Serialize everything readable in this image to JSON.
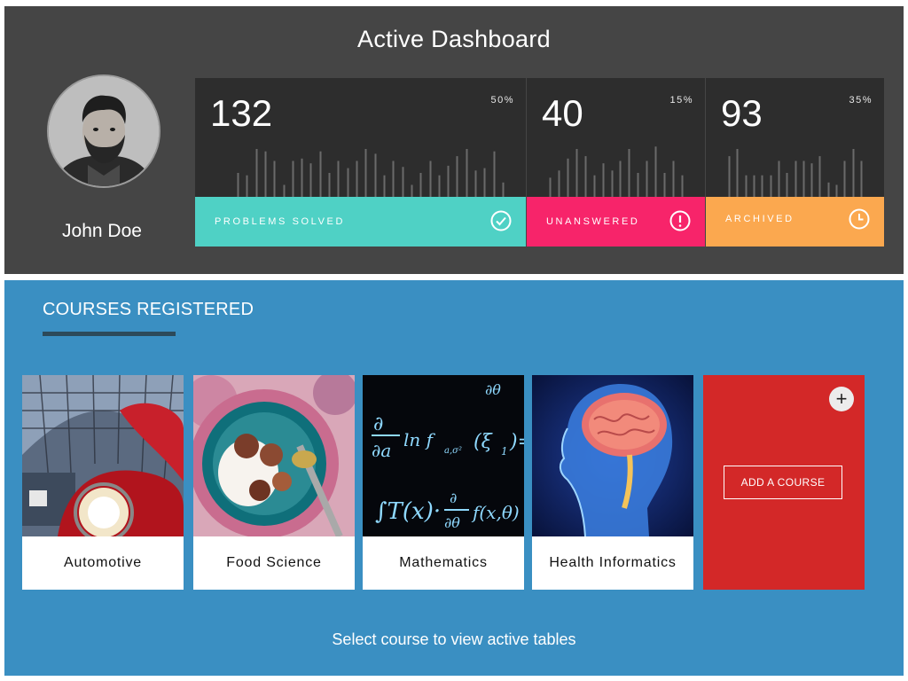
{
  "dashboard": {
    "title": "Active Dashboard",
    "user": {
      "name": "John Doe",
      "avatar_icon": "user-avatar-photo"
    },
    "stats": [
      {
        "value": "132",
        "percent": "50%",
        "label": "PROBLEMS SOLVED",
        "icon": "check-circle-icon",
        "color": "#4fd1c5",
        "bars": [
          0.2,
          0.18,
          0.4,
          0.38,
          0.3,
          0.1,
          0.3,
          0.32,
          0.28,
          0.38,
          0.2,
          0.3,
          0.24,
          0.3,
          0.4,
          0.36,
          0.18,
          0.3,
          0.25,
          0.1,
          0.2,
          0.3,
          0.18,
          0.26,
          0.34,
          0.4,
          0.22,
          0.24,
          0.38,
          0.12
        ]
      },
      {
        "value": "40",
        "percent": "15%",
        "label": "UNANSWERED",
        "icon": "exclamation-circle-icon",
        "color": "#f7246a",
        "bars": [
          0.16,
          0.22,
          0.32,
          0.4,
          0.34,
          0.18,
          0.28,
          0.22,
          0.3,
          0.4,
          0.2,
          0.3,
          0.42,
          0.2,
          0.3,
          0.18
        ]
      },
      {
        "value": "93",
        "percent": "35%",
        "label": "ARCHIVED",
        "icon": "clock-icon",
        "color": "#fba84f",
        "bars": [
          0.34,
          0.4,
          0.18,
          0.18,
          0.18,
          0.18,
          0.3,
          0.2,
          0.3,
          0.3,
          0.28,
          0.34,
          0.12,
          0.1,
          0.3,
          0.4,
          0.3
        ]
      }
    ]
  },
  "courses": {
    "title": "COURSES REGISTERED",
    "items": [
      {
        "name": "Automotive",
        "image_icon": "vintage-car-photo"
      },
      {
        "name": "Food Science",
        "image_icon": "figs-bowl-photo"
      },
      {
        "name": "Mathematics",
        "image_icon": "equations-photo"
      },
      {
        "name": "Health Informatics",
        "image_icon": "brain-scan-photo"
      }
    ],
    "add_button_label": "ADD A COURSE",
    "add_icon": "plus-icon",
    "hint": "Select course to view active tables"
  }
}
